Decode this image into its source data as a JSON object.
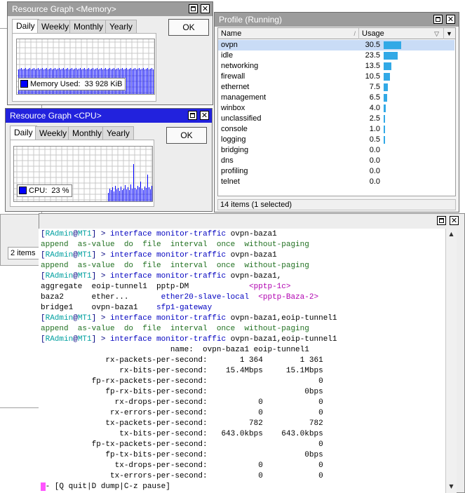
{
  "background_windows": {
    "items_count": "2 items"
  },
  "memory_window": {
    "title": "Resource Graph <Memory>",
    "tabs": [
      "Daily",
      "Weekly",
      "Monthly",
      "Yearly"
    ],
    "ok_label": "OK",
    "legend_label": "Memory Used:",
    "legend_value": "33 928 KiB",
    "bar_color": "#0000ff"
  },
  "cpu_window": {
    "title": "Resource Graph <CPU>",
    "tabs": [
      "Daily",
      "Weekly",
      "Monthly",
      "Yearly"
    ],
    "ok_label": "OK",
    "legend_label": "CPU:",
    "legend_value": "23 %",
    "bar_color": "#0000ff"
  },
  "profile_window": {
    "title": "Profile (Running)",
    "columns": [
      "Name",
      "Usage"
    ],
    "rows": [
      {
        "name": "ovpn",
        "usage": "30.5",
        "level": 30.5,
        "selected": true
      },
      {
        "name": "idle",
        "usage": "23.5",
        "level": 23.5
      },
      {
        "name": "networking",
        "usage": "13.5",
        "level": 13.5
      },
      {
        "name": "firewall",
        "usage": "10.5",
        "level": 10.5
      },
      {
        "name": "ethernet",
        "usage": "7.5",
        "level": 7.5
      },
      {
        "name": "management",
        "usage": "6.5",
        "level": 6.5
      },
      {
        "name": "winbox",
        "usage": "4.0",
        "level": 4.0
      },
      {
        "name": "unclassified",
        "usage": "2.5",
        "level": 2.5
      },
      {
        "name": "console",
        "usage": "1.0",
        "level": 1.0
      },
      {
        "name": "logging",
        "usage": "0.5",
        "level": 0.5
      },
      {
        "name": "bridging",
        "usage": "0.0",
        "level": 0
      },
      {
        "name": "dns",
        "usage": "0.0",
        "level": 0
      },
      {
        "name": "profiling",
        "usage": "0.0",
        "level": 0
      },
      {
        "name": "telnet",
        "usage": "0.0",
        "level": 0
      }
    ],
    "status": "14 items (1 selected)",
    "bar_color": "#32a9e6"
  },
  "terminal": {
    "prompt_user": "RAdmin",
    "prompt_host": "MT1",
    "lines": [
      {
        "t": "prompt",
        "cmd": "interface monitor-traffic",
        "arg": "ovpn-baza1"
      },
      {
        "t": "green",
        "text": "append  as-value  do  file  interval  once  without-paging"
      },
      {
        "t": "prompt",
        "cmd": "interface monitor-traffic",
        "arg": "ovpn-baza1"
      },
      {
        "t": "green",
        "text": "append  as-value  do  file  interval  once  without-paging"
      },
      {
        "t": "prompt",
        "cmd": "interface monitor-traffic",
        "arg": "ovpn-baza1,"
      },
      {
        "t": "cols",
        "parts": [
          [
            "aggregate  eoip-tunnel1  pptp-DM             ",
            "plain"
          ],
          [
            "<pptp-1c>",
            "mag"
          ]
        ]
      },
      {
        "t": "cols",
        "parts": [
          [
            "baza2      ether...       ",
            "plain"
          ],
          [
            "ether20-slave-local  ",
            "cmd"
          ],
          [
            "<pptp-Baza-2>",
            "mag"
          ]
        ]
      },
      {
        "t": "cols",
        "parts": [
          [
            "bridge1    ovpn-baza1    ",
            "plain"
          ],
          [
            "sfp1-gateway",
            "cmd"
          ]
        ]
      },
      {
        "t": "prompt",
        "cmd": "interface monitor-traffic",
        "arg": "ovpn-baza1,eoip-tunnel1"
      },
      {
        "t": "green",
        "text": "append  as-value  do  file  interval  once  without-paging"
      },
      {
        "t": "prompt",
        "cmd": "interface monitor-traffic",
        "arg": "ovpn-baza1,eoip-tunnel1"
      },
      {
        "t": "plain",
        "text": "                            name:  ovpn-baza1 eoip-tunnel1"
      },
      {
        "t": "plain",
        "text": "              rx-packets-per-second:       1 364        1 361"
      },
      {
        "t": "plain",
        "text": "                 rx-bits-per-second:    15.4Mbps     15.1Mbps"
      },
      {
        "t": "plain",
        "text": "           fp-rx-packets-per-second:                        0"
      },
      {
        "t": "plain",
        "text": "              fp-rx-bits-per-second:                     0bps"
      },
      {
        "t": "plain",
        "text": "                rx-drops-per-second:           0            0"
      },
      {
        "t": "plain",
        "text": "               rx-errors-per-second:           0            0"
      },
      {
        "t": "plain",
        "text": "              tx-packets-per-second:         782          782"
      },
      {
        "t": "plain",
        "text": "                 tx-bits-per-second:   643.0kbps    643.0kbps"
      },
      {
        "t": "plain",
        "text": "           fp-tx-packets-per-second:                        0"
      },
      {
        "t": "plain",
        "text": "              fp-tx-bits-per-second:                     0bps"
      },
      {
        "t": "plain",
        "text": "                tx-drops-per-second:           0            0"
      },
      {
        "t": "plain",
        "text": "               tx-errors-per-second:           0            0"
      },
      {
        "t": "footer",
        "text": "- [Q quit|D dump|C-z pause]"
      }
    ]
  }
}
